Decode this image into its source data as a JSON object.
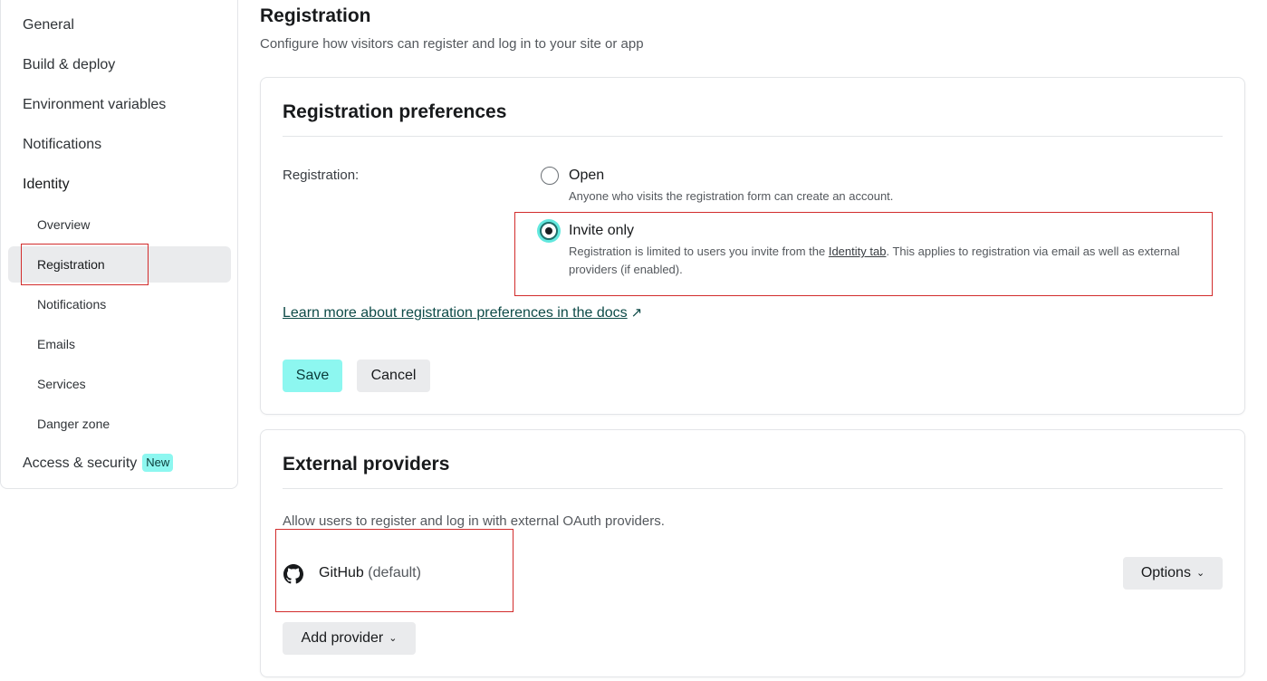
{
  "sidebar": {
    "items": [
      {
        "label": "General"
      },
      {
        "label": "Build & deploy"
      },
      {
        "label": "Environment variables"
      },
      {
        "label": "Notifications"
      },
      {
        "label": "Identity"
      }
    ],
    "identity_subitems": [
      {
        "label": "Overview"
      },
      {
        "label": "Registration",
        "active": true
      },
      {
        "label": "Notifications"
      },
      {
        "label": "Emails"
      },
      {
        "label": "Services"
      },
      {
        "label": "Danger zone"
      }
    ],
    "access_security": {
      "label": "Access & security",
      "badge": "New"
    }
  },
  "header": {
    "title": "Registration",
    "subtitle": "Configure how visitors can register and log in to your site or app"
  },
  "registration_card": {
    "title": "Registration preferences",
    "field_label": "Registration:",
    "options": [
      {
        "title": "Open",
        "description": "Anyone who visits the registration form can create an account.",
        "selected": false
      },
      {
        "title": "Invite only",
        "description_before": "Registration is limited to users you invite from the ",
        "description_link": "Identity tab",
        "description_after": ". This applies to registration via email as well as external providers (if enabled).",
        "selected": true
      }
    ],
    "docs_link": "Learn more about registration preferences in the docs",
    "docs_arrow": "↗",
    "save_label": "Save",
    "cancel_label": "Cancel"
  },
  "providers_card": {
    "title": "External providers",
    "description": "Allow users to register and log in with external OAuth providers.",
    "providers": [
      {
        "name": "GitHub",
        "suffix": "(default)",
        "icon": "github-icon",
        "options_label": "Options"
      }
    ],
    "add_provider_label": "Add provider"
  },
  "colors": {
    "accent": "#8df7f0",
    "annotation_red": "#d22c2c"
  }
}
